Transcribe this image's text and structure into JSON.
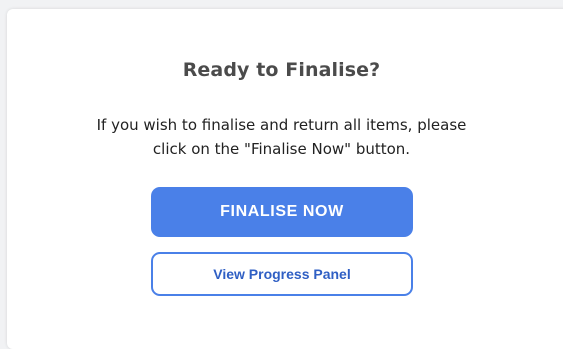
{
  "dialog": {
    "title": "Ready to Finalise?",
    "message_line1": "If you wish to finalise and return all items, please",
    "message_line2": "click on the \"Finalise Now\" button.",
    "primary_button_label": "FINALISE NOW",
    "secondary_button_label": "View Progress Panel"
  },
  "colors": {
    "accent": "#4a80e8",
    "background": "#ffffff",
    "title_text": "#4b4b4b"
  }
}
